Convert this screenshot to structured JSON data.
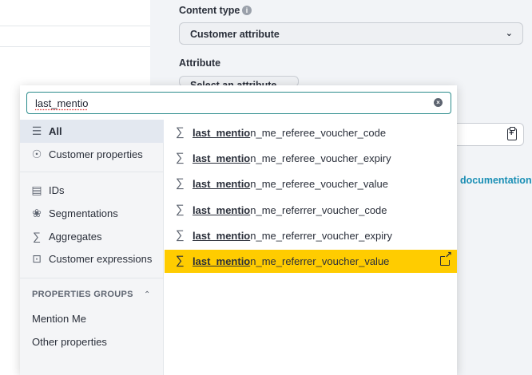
{
  "background": {
    "content_type_label": "Content type",
    "content_type_value": "Customer attribute",
    "attribute_label": "Attribute",
    "attribute_select_partial": "Select an attribute",
    "documentation_link": "documentation"
  },
  "search": {
    "value": "last_mentio"
  },
  "sidebar": {
    "items": [
      {
        "label": "All",
        "icon": "list-icon"
      },
      {
        "label": "Customer properties",
        "icon": "person-icon"
      },
      {
        "label": "IDs",
        "icon": "id-card-icon"
      },
      {
        "label": "Segmentations",
        "icon": "segmentations-icon"
      },
      {
        "label": "Aggregates",
        "icon": "sigma-icon"
      },
      {
        "label": "Customer expressions",
        "icon": "expression-icon"
      }
    ],
    "group_title": "PROPERTIES GROUPS",
    "groups": [
      "Mention Me",
      "Other properties"
    ]
  },
  "results": {
    "items": [
      {
        "match": "last_mentio",
        "rest": "n_me_referee_voucher_code"
      },
      {
        "match": "last_mentio",
        "rest": "n_me_referee_voucher_expiry"
      },
      {
        "match": "last_mentio",
        "rest": "n_me_referee_voucher_value"
      },
      {
        "match": "last_mentio",
        "rest": "n_me_referrer_voucher_code"
      },
      {
        "match": "last_mentio",
        "rest": "n_me_referrer_voucher_expiry"
      },
      {
        "match": "last_mentio",
        "rest": "n_me_referrer_voucher_value"
      }
    ],
    "highlight_color": "#ffcc00"
  }
}
